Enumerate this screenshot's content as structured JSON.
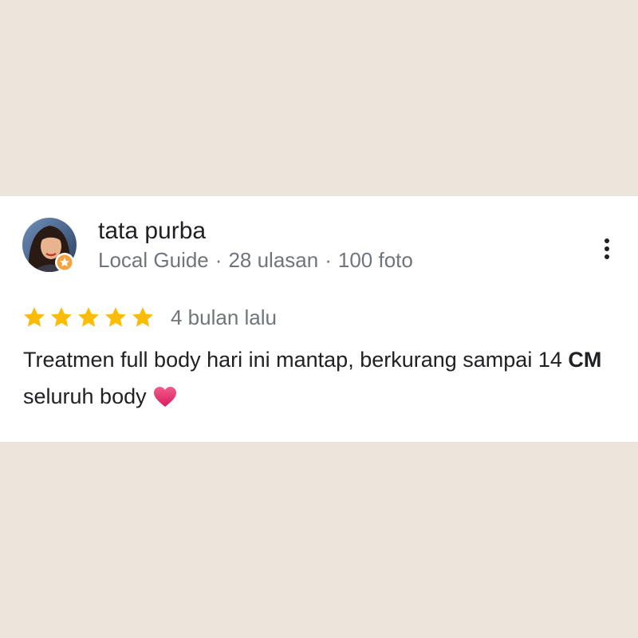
{
  "review": {
    "author_name": "tata purba",
    "author_badge": "Local Guide",
    "reviews_count": "28 ulasan",
    "photos_count": "100 foto",
    "separator": "·",
    "rating": 5,
    "rating_max": 5,
    "time_ago": "4 bulan lalu",
    "text_part1": "Treatmen full body hari ini mantap, berkurang sampai 14 ",
    "text_bold": "CM",
    "text_part2": " seluruh body",
    "emoji_icon": "heart-icon"
  },
  "colors": {
    "background": "#ede4db",
    "card": "#ffffff",
    "star": "#fbbc04",
    "heart": "#e8356d",
    "text_primary": "#202124",
    "text_secondary": "#70757a"
  }
}
